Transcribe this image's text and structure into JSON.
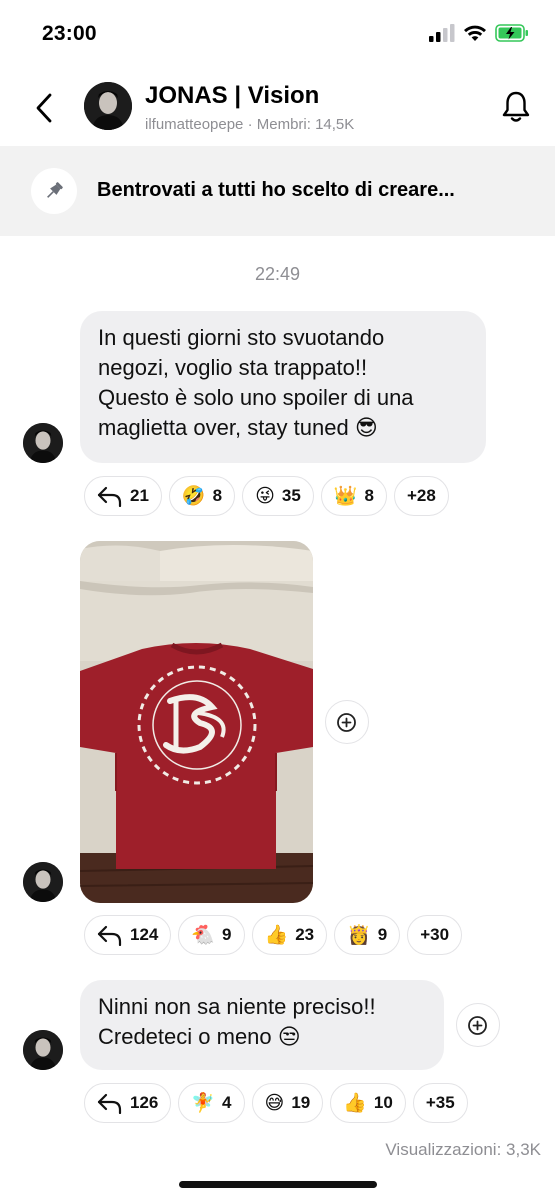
{
  "status": {
    "time": "23:00"
  },
  "header": {
    "title": "JONAS | Vision",
    "username": "ilfumatteopepe",
    "members": "· Membri: 14,5K"
  },
  "pinned": {
    "text": "Bentrovati a tutti ho scelto di creare..."
  },
  "timestamp": "22:49",
  "messages": [
    {
      "lines": [
        "In questi giorni sto svuotando",
        "negozi, voglio sta trappato!!",
        "Questo è solo uno spoiler di una",
        "maglietta over, stay tuned 😎"
      ],
      "replies": "21",
      "reactions": [
        {
          "emoji": "🤣",
          "count": "8"
        },
        {
          "emoji": "😜",
          "count": "35"
        },
        {
          "emoji": "👑",
          "count": "8"
        }
      ],
      "more": "+28"
    },
    {
      "image": "red-tshirt-photo",
      "replies": "124",
      "reactions": [
        {
          "emoji": "🐔",
          "count": "9"
        },
        {
          "emoji": "👍",
          "count": "23"
        },
        {
          "emoji": "👸",
          "count": "9"
        }
      ],
      "more": "+30"
    },
    {
      "lines": [
        "Ninni non sa niente preciso!!",
        "Credeteci o meno 😒"
      ],
      "replies": "126",
      "reactions": [
        {
          "emoji": "🧚",
          "count": "4"
        },
        {
          "emoji": "😅",
          "count": "19"
        },
        {
          "emoji": "👍",
          "count": "10"
        }
      ],
      "more": "+35"
    }
  ],
  "footer": {
    "views": "Visualizzazioni: 3,3K"
  },
  "colors": {
    "bubble": "#efeff1",
    "pinned_bg": "#f2f2f2",
    "shirt": "#9e1f2a",
    "battery": "#34c759"
  }
}
